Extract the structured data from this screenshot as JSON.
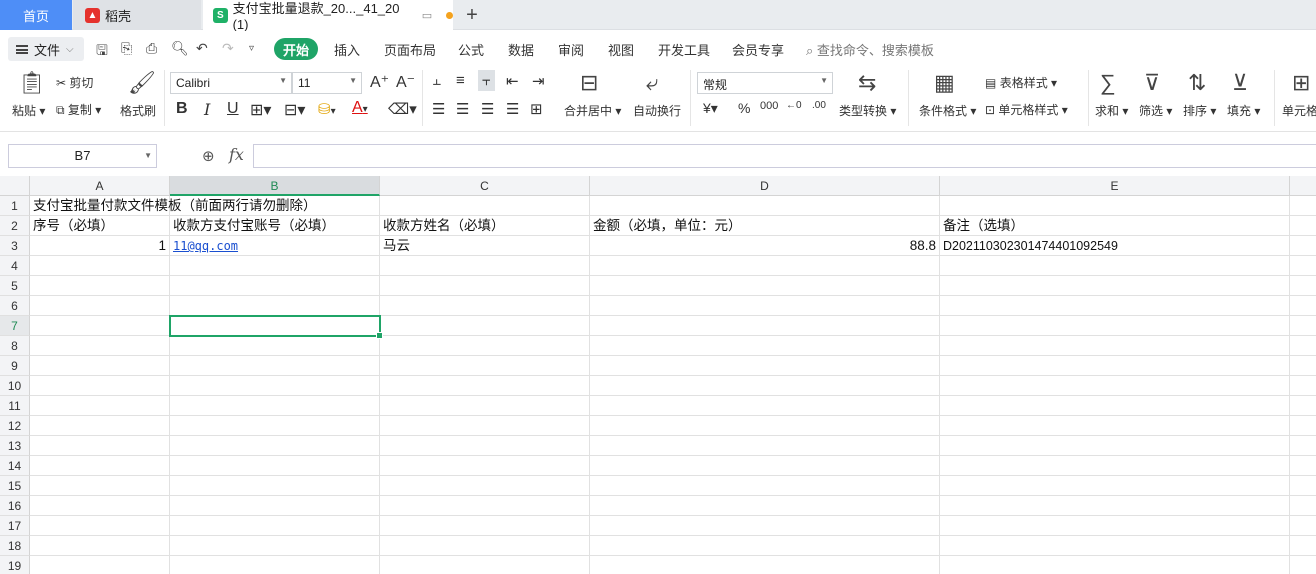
{
  "tabs": {
    "home": "首页",
    "daoke": "稻壳",
    "file": "支付宝批量退款_20..._41_20 (1)",
    "add": "+"
  },
  "menu": {
    "file": "文件",
    "start": "开始",
    "items": [
      "插入",
      "页面布局",
      "公式",
      "数据",
      "审阅",
      "视图",
      "开发工具",
      "会员专享"
    ],
    "search": "查找命令、搜索模板"
  },
  "ribbon": {
    "paste": "粘贴",
    "cut": "剪切",
    "copy": "复制",
    "format_painter": "格式刷",
    "font": "Calibri",
    "size": "11",
    "merge": "合并居中",
    "wrap": "自动换行",
    "numfmt": "常规",
    "convert": "类型转换",
    "cond_format": "条件格式",
    "table_style": "表格样式",
    "cell_style": "单元格样式",
    "sum": "求和",
    "filter": "筛选",
    "sort": "排序",
    "fill": "填充",
    "cell": "单元格"
  },
  "formula_bar": {
    "name_box": "B7",
    "fx": "fx",
    "value": ""
  },
  "columns": [
    "A",
    "B",
    "C",
    "D",
    "E"
  ],
  "rows": [
    "1",
    "2",
    "3",
    "4",
    "5",
    "6",
    "7",
    "8",
    "9",
    "10",
    "11",
    "12",
    "13",
    "14",
    "15",
    "16",
    "17",
    "18",
    "19"
  ],
  "cells": {
    "A1": "支付宝批量付款文件模板（前面两行请勿删除）",
    "A2": "序号（必填）",
    "B2": "收款方支付宝账号（必填）",
    "C2": "收款方姓名（必填）",
    "D2": "金额（必填，单位：元）",
    "E2": "备注（选填）",
    "A3": "1",
    "B3": "11@qq.com",
    "C3": "马云",
    "D3": "88.8",
    "E3": "D20211030230147440109254​9"
  },
  "selected_cell": "B7",
  "colors": {
    "accent": "#1fa467",
    "home_tab": "#4e8ef7",
    "link": "#1a4fd0"
  }
}
